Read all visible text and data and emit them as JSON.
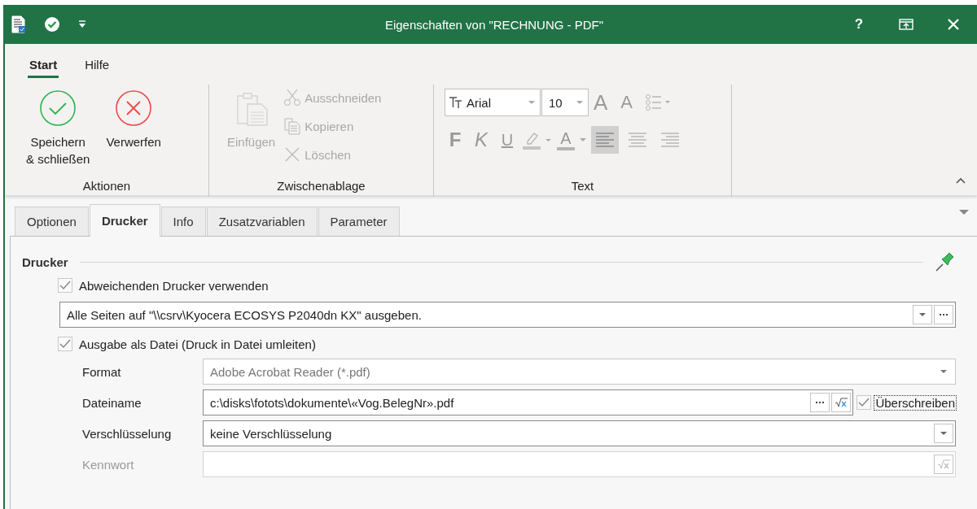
{
  "window": {
    "title": "Eigenschaften von \"RECHNUNG - PDF\"",
    "help": "?"
  },
  "ribbon_tabs": [
    {
      "label": "Start",
      "selected": true
    },
    {
      "label": "Hilfe",
      "selected": false
    }
  ],
  "actions_group": {
    "label": "Aktionen",
    "items": [
      {
        "kind": "save",
        "label": "Speichern\n& schließen",
        "disabled": false
      },
      {
        "kind": "discard",
        "label": "Verwerfen",
        "disabled": false
      }
    ]
  },
  "clipboard_group": {
    "label": "Zwischenablage",
    "paste": {
      "label": "Einfügen",
      "disabled": true
    },
    "items": [
      {
        "kind": "cut",
        "label": "Ausschneiden",
        "disabled": true
      },
      {
        "kind": "copy",
        "label": "Kopieren",
        "disabled": true
      },
      {
        "kind": "delete",
        "label": "Löschen",
        "disabled": true
      }
    ]
  },
  "text_group": {
    "label": "Text",
    "font": "Arial",
    "size": "10",
    "row1": [
      {
        "kind": "grow",
        "label": "A"
      },
      {
        "kind": "shrink",
        "label": "A"
      },
      {
        "kind": "list"
      }
    ],
    "row2": [
      {
        "kind": "bold",
        "label": "F",
        "selected": false
      },
      {
        "kind": "italic",
        "label": "K",
        "selected": false
      },
      {
        "kind": "underline",
        "label": "U",
        "selected": false
      },
      {
        "kind": "highlight",
        "selected": false
      },
      {
        "kind": "fontcolor",
        "label": "A",
        "selected": false
      },
      {
        "kind": "align-left",
        "selected": true
      },
      {
        "kind": "align-center",
        "selected": false
      },
      {
        "kind": "align-right",
        "selected": false
      }
    ]
  },
  "dialog_tabs": [
    {
      "label": "Optionen",
      "selected": false
    },
    {
      "label": "Drucker",
      "selected": true
    },
    {
      "label": "Info",
      "selected": false
    },
    {
      "label": "Zusatzvariablen",
      "selected": false
    },
    {
      "label": "Parameter",
      "selected": false
    }
  ],
  "section": {
    "title": "Drucker"
  },
  "use_other_printer": {
    "label": "Abweichenden Drucker verwenden",
    "checked": true
  },
  "printer": {
    "value": "Alle Seiten auf \"\\\\csrv\\Kyocera ECOSYS P2040dn KX\" ausgeben."
  },
  "output_to_file": {
    "label": "Ausgabe als Datei (Druck in Datei umleiten)",
    "checked": true
  },
  "fields": [
    {
      "kind": "locked-combo",
      "label": "Format",
      "value": "Adobe Acrobat Reader (*.pdf)",
      "disabled": false
    },
    {
      "kind": "path",
      "label": "Dateiname",
      "value": "c:\\disks\\fotots\\dokumente\\«Vog.BelegNr».pdf",
      "disabled": false,
      "overwrite": {
        "label": "Überschreiben",
        "checked": true
      }
    },
    {
      "kind": "combo",
      "label": "Verschlüsselung",
      "value": "keine Verschlüsselung",
      "disabled": false
    },
    {
      "kind": "formula",
      "label": "Kennwort",
      "disabled": true
    }
  ]
}
